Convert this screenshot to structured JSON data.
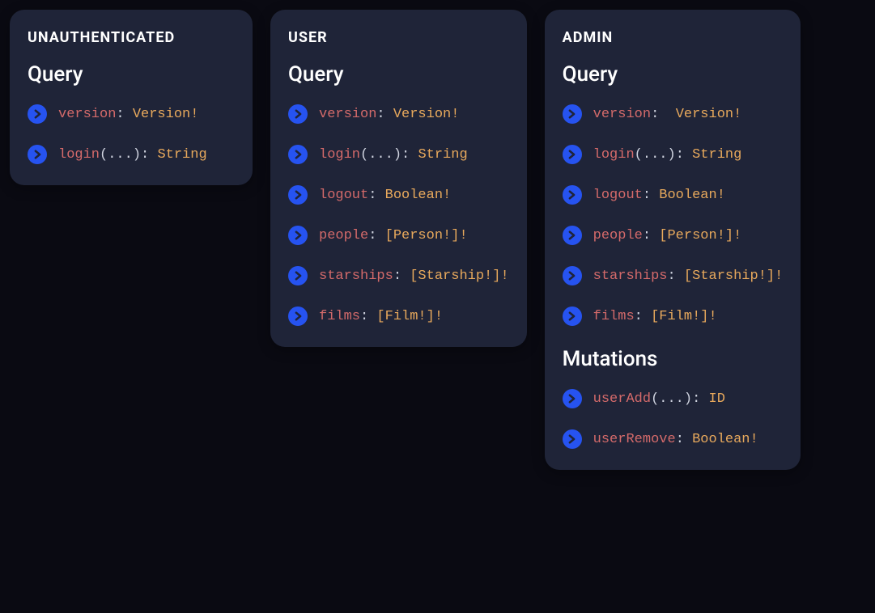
{
  "cards": [
    {
      "title": "UNAUTHENTICATED",
      "sections": [
        {
          "heading": "Query",
          "fields": [
            {
              "name": "version",
              "args": "",
              "sep": ": ",
              "type": "Version!"
            },
            {
              "name": "login",
              "args": "(...)",
              "sep": ": ",
              "type": "String"
            }
          ]
        }
      ]
    },
    {
      "title": "USER",
      "sections": [
        {
          "heading": "Query",
          "fields": [
            {
              "name": "version",
              "args": "",
              "sep": ": ",
              "type": "Version!"
            },
            {
              "name": "login",
              "args": "(...)",
              "sep": ": ",
              "type": "String"
            },
            {
              "name": "logout",
              "args": "",
              "sep": ": ",
              "type": "Boolean!"
            },
            {
              "name": "people",
              "args": "",
              "sep": ": ",
              "type": "[Person!]!"
            },
            {
              "name": "starships",
              "args": "",
              "sep": ": ",
              "type": "[Starship!]!"
            },
            {
              "name": "films",
              "args": "",
              "sep": ": ",
              "type": "[Film!]!"
            }
          ]
        }
      ]
    },
    {
      "title": "ADMIN",
      "sections": [
        {
          "heading": "Query",
          "fields": [
            {
              "name": "version",
              "args": "",
              "sep": ":  ",
              "type": "Version!"
            },
            {
              "name": "login",
              "args": "(...)",
              "sep": ": ",
              "type": "String"
            },
            {
              "name": "logout",
              "args": "",
              "sep": ": ",
              "type": "Boolean!"
            },
            {
              "name": "people",
              "args": "",
              "sep": ": ",
              "type": "[Person!]!"
            },
            {
              "name": "starships",
              "args": "",
              "sep": ": ",
              "type": "[Starship!]!"
            },
            {
              "name": "films",
              "args": "",
              "sep": ": ",
              "type": "[Film!]!"
            }
          ]
        },
        {
          "heading": "Mutations",
          "fields": [
            {
              "name": "userAdd",
              "args": "(...)",
              "sep": ": ",
              "type": "ID"
            },
            {
              "name": "userRemove",
              "args": "",
              "sep": ": ",
              "type": "Boolean!"
            }
          ]
        }
      ]
    }
  ]
}
